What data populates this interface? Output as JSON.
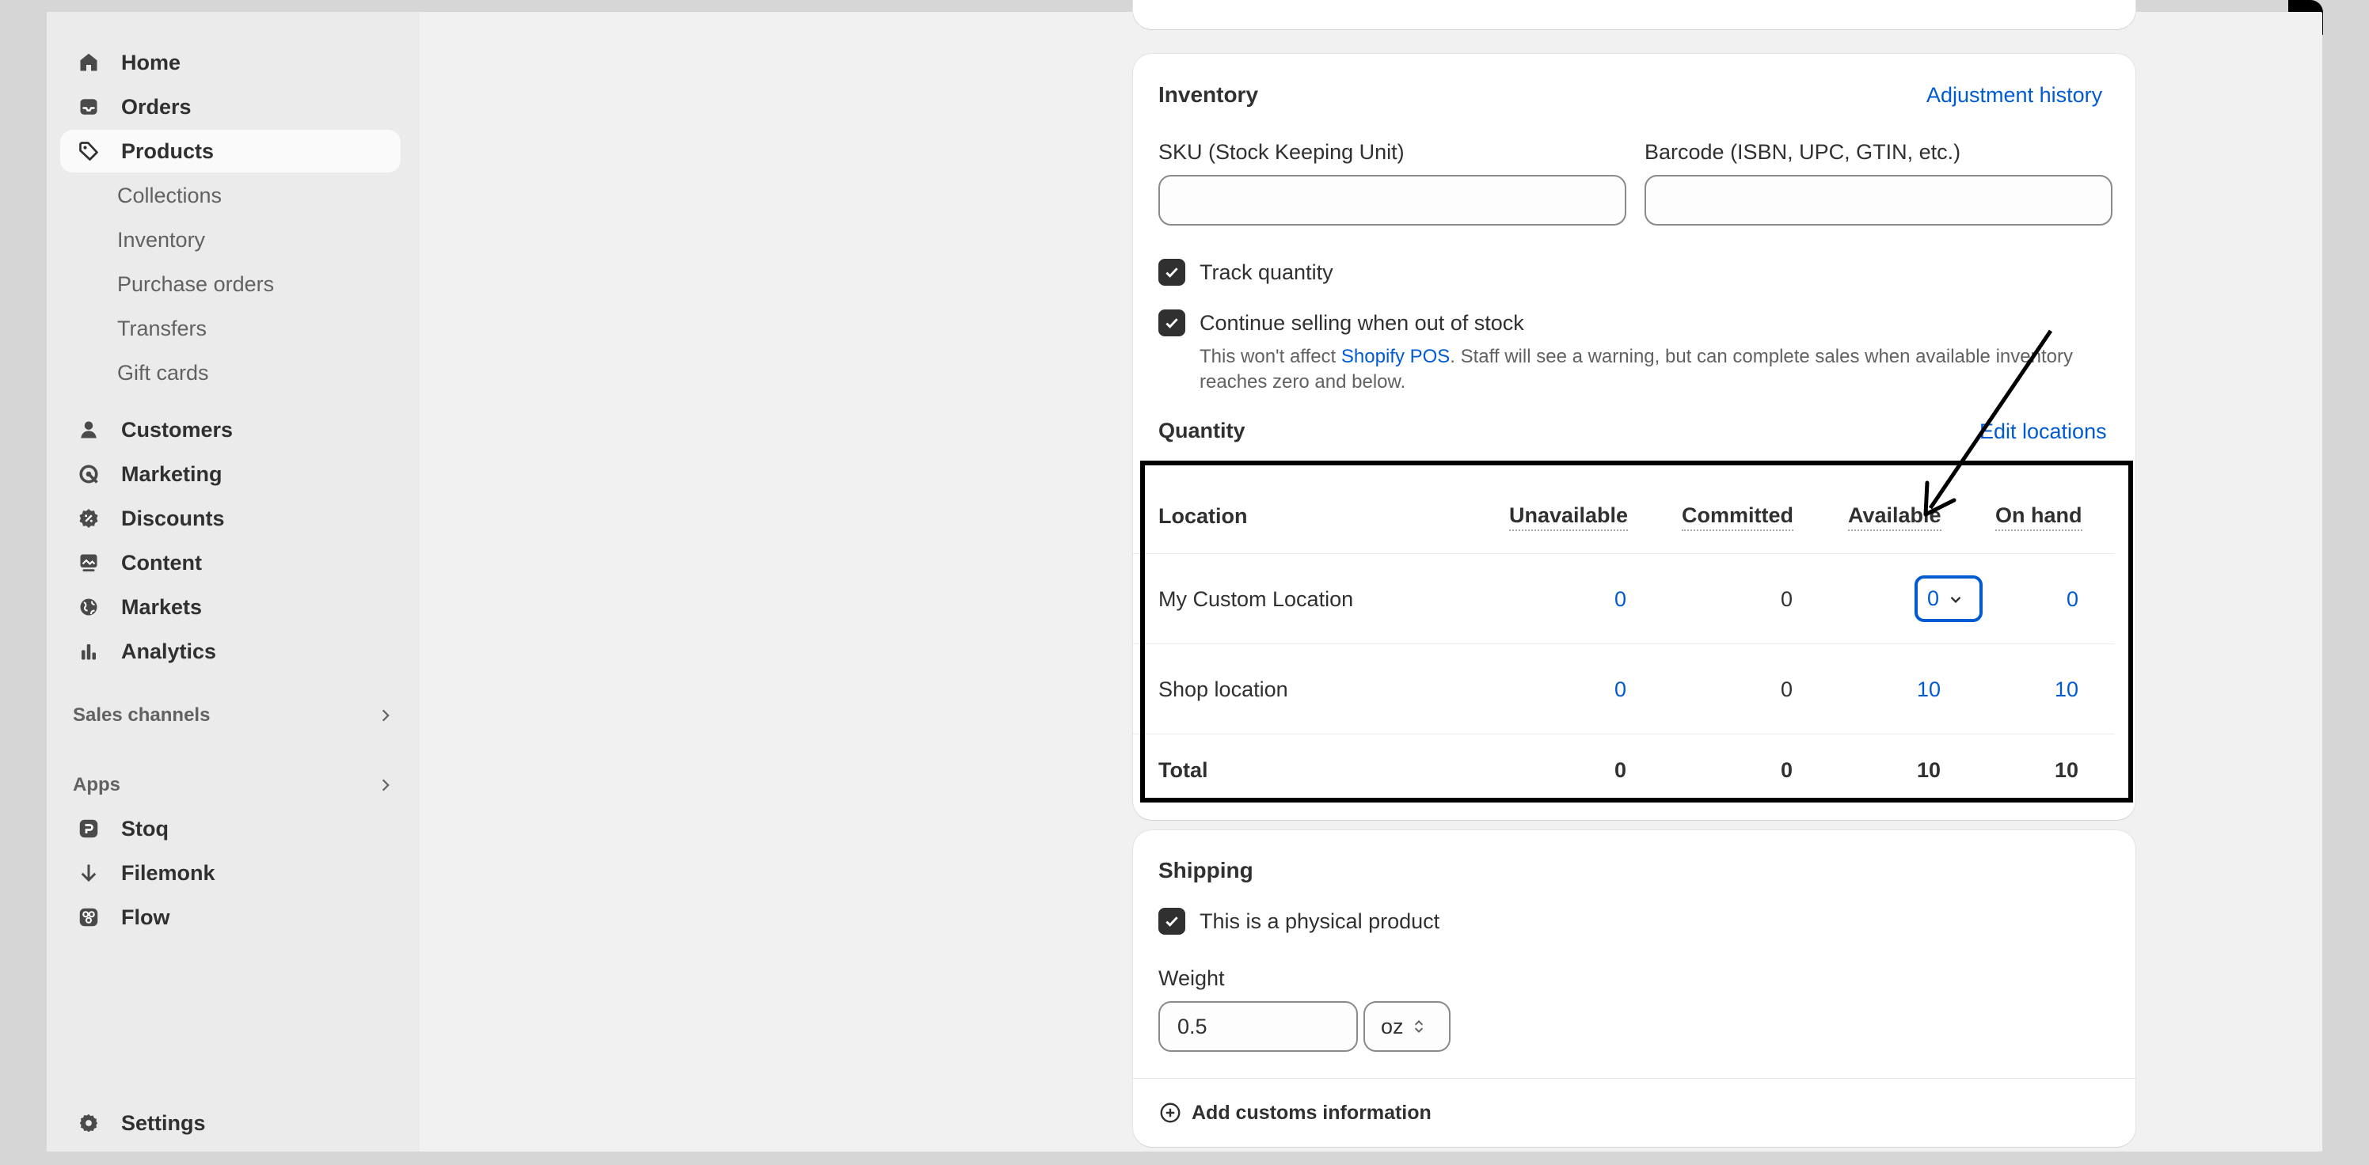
{
  "sidebar": {
    "items": [
      {
        "label": "Home",
        "icon": "home-icon"
      },
      {
        "label": "Orders",
        "icon": "inbox-icon"
      },
      {
        "label": "Products",
        "icon": "tag-icon"
      },
      {
        "label": "Customers",
        "icon": "person-icon"
      },
      {
        "label": "Marketing",
        "icon": "target-icon"
      },
      {
        "label": "Discounts",
        "icon": "discount-icon"
      },
      {
        "label": "Content",
        "icon": "image-icon"
      },
      {
        "label": "Markets",
        "icon": "globe-icon"
      },
      {
        "label": "Analytics",
        "icon": "bar-chart-icon"
      }
    ],
    "product_sub_items": [
      "Collections",
      "Inventory",
      "Purchase orders",
      "Transfers",
      "Gift cards"
    ],
    "sales_channels_label": "Sales channels",
    "apps_label": "Apps",
    "apps": [
      {
        "label": "Stoq",
        "icon": "stoq-app-icon"
      },
      {
        "label": "Filemonk",
        "icon": "arrow-down-icon"
      },
      {
        "label": "Flow",
        "icon": "flow-app-icon"
      }
    ],
    "settings_label": "Settings"
  },
  "inventory": {
    "title": "Inventory",
    "adjustment_history": "Adjustment history",
    "sku_label": "SKU (Stock Keeping Unit)",
    "sku_value": "",
    "barcode_label": "Barcode (ISBN, UPC, GTIN, etc.)",
    "barcode_value": "",
    "track_quantity": "Track quantity",
    "continue_selling": "Continue selling when out of stock",
    "help_prefix": "This won't affect ",
    "help_link": "Shopify POS",
    "help_suffix": ". Staff will see a warning, but can complete sales when available inventory reaches zero and below.",
    "quantity_title": "Quantity",
    "edit_locations": "Edit locations",
    "table": {
      "headers": [
        "Location",
        "Unavailable",
        "Committed",
        "Available",
        "On hand"
      ],
      "rows": [
        {
          "location": "My Custom Location",
          "unavailable": "0",
          "committed": "0",
          "available": "0",
          "on_hand": "0"
        },
        {
          "location": "Shop location",
          "unavailable": "0",
          "committed": "0",
          "available": "10",
          "on_hand": "10"
        }
      ],
      "total": {
        "label": "Total",
        "unavailable": "0",
        "committed": "0",
        "available": "10",
        "on_hand": "10"
      }
    }
  },
  "shipping": {
    "title": "Shipping",
    "physical_product": "This is a physical product",
    "weight_label": "Weight",
    "weight_value": "0.5",
    "weight_unit": "oz",
    "add_customs": "Add customs information"
  },
  "colors": {
    "accent": "#005bd3",
    "text": "#303030",
    "muted": "#616161",
    "background": "#f1f1f1"
  }
}
